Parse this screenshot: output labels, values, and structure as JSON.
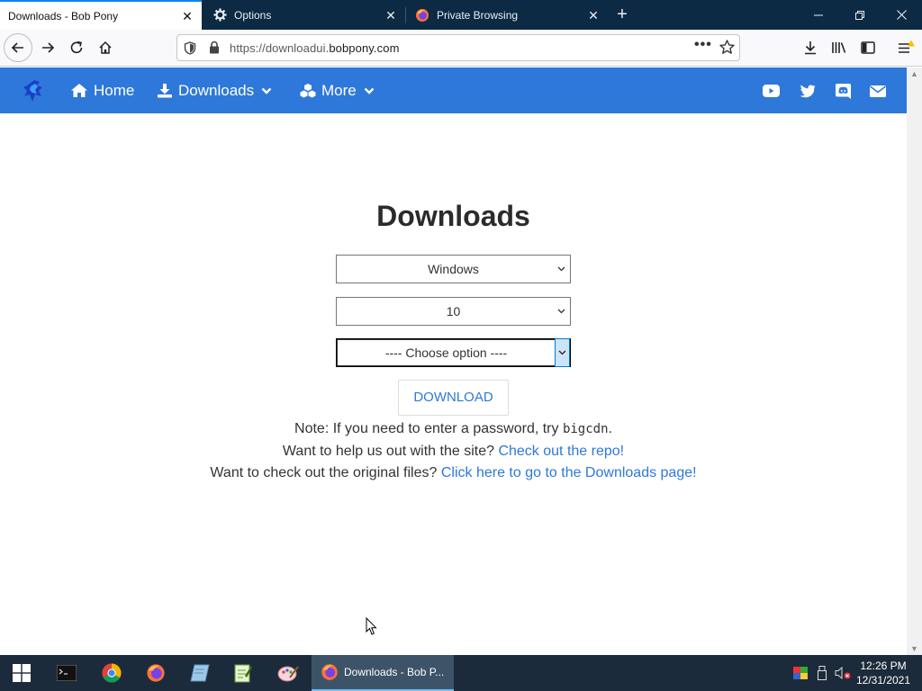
{
  "browser": {
    "tabs": [
      {
        "title": "Downloads - Bob Pony",
        "active": true
      },
      {
        "title": "Options",
        "icon": "gear-icon"
      },
      {
        "title": "Private Browsing",
        "icon": "firefox-icon"
      }
    ],
    "url": {
      "prefix": "https://downloadui.",
      "domain": "bobpony.com"
    }
  },
  "site_nav": {
    "home_label": "Home",
    "downloads_label": "Downloads",
    "more_label": "More",
    "social": [
      "youtube-icon",
      "twitter-icon",
      "discord-icon",
      "mail-icon"
    ]
  },
  "main": {
    "title": "Downloads",
    "selects": {
      "os": "Windows",
      "version": "10",
      "option": "---- Choose option ----"
    },
    "download_label": "DOWNLOAD",
    "note_prefix": "Note: If you need to enter a password, try ",
    "note_password": "bigcdn",
    "note_suffix": ".",
    "help_prefix": "Want to help us out with the site? ",
    "help_link": "Check out the repo!",
    "files_prefix": "Want to check out the original files? ",
    "files_link": "Click here to go to the Downloads page!"
  },
  "taskbar": {
    "active_window": "Downloads - Bob P...",
    "time": "12:26 PM",
    "date": "12/31/2021"
  },
  "colors": {
    "nav_blue": "#2e78da",
    "tab_bar": "#0c2a43",
    "link": "#2e78da"
  }
}
